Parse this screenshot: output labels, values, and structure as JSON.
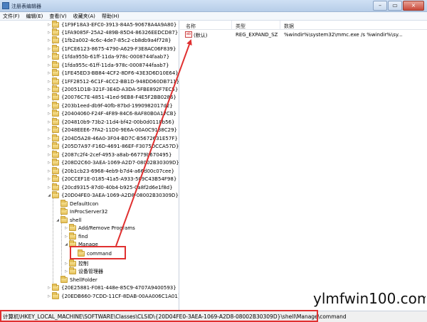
{
  "window": {
    "title": "注册表编辑器",
    "buttons": [
      "–",
      "▭",
      "×"
    ]
  },
  "menu": [
    "文件(F)",
    "编辑(E)",
    "查看(V)",
    "收藏夹(A)",
    "帮助(H)"
  ],
  "tree": [
    "{1F9F18A3-EFC0-3913-84A5-90678A4A9A80}",
    "{1FA9085F-25A2-489B-85D4-86326EEDCD87}",
    "{1fb2a002-4c6c-4de7-85c2-cb8db9a4f728}",
    "{1FCE6123-8675-4790-A629-F3E8AC06F839}",
    "{1fda955b-61ff-11da-978c-0008744faab7}",
    "{1fda955c-61ff-11da-978c-0008744faab7}",
    "{1FE45ED3-BB84-4CF2-8DF6-43E3D6D10E64}",
    "{1FF28512-6C1F-4CC2-BB1D-948DD60DB711}",
    "{20051D1B-321F-3E4D-A3DA-5FBE892F7EC5}",
    "{20076C7E-4851-41ed-9EB8-F4E5F2BB0286}",
    "{203b1eed-db9f-40fb-87bd-1990982017d2}",
    "{20404060-F24F-4F89-84C6-8AF80B0A17CB}",
    "{204810b9-73b2-11d4-bf42-00b0d0118b56}",
    "{2048EEE6-7FA2-11D0-9E6A-00A0C9138C29}",
    "{204D5A28-46A0-3F04-BD7C-B5672631E57F}",
    "{205D7A97-F16D-4691-86EF-F3075DCCA57D}",
    "{2087c2f4-2cef-4953-a8ab-66779b670495}",
    "{208D2C60-3AEA-1069-A2D7-08002B30309D}",
    "{20b1cb23-6968-4eb9-b7d4-a66d00c07cee}",
    "{20CCEF1E-0185-41a5-A933-509C43B54F98}",
    "{20cd9315-87d0-40b4-b925-0a8f2d6e1f8d}",
    "{20D04FE0-3AEA-1069-A2D8-08002B30309D}",
    "DefaultIcon",
    "InProcServer32",
    "shell",
    "Add/Remove Programs",
    "find",
    "Manage",
    "command",
    "控制",
    "设备管理器",
    "ShellFolder",
    "{20E25881-F081-448e-85C9-4707A9400593}",
    "{20EDB660-7CDD-11CF-8DAB-00AA006C1A01}"
  ],
  "list": {
    "headers": [
      "名称",
      "类型",
      "数据"
    ],
    "row": {
      "name": "(默认)",
      "icon": "ab",
      "type": "REG_EXPAND_SZ",
      "data": "%windir%\\system32\\mmc.exe /s %windir%\\sy..."
    }
  },
  "status": {
    "path": "计算机\\HKEY_LOCAL_MACHINE\\SOFTWARE\\Classes\\CLSID\\{20D04FE0-3AEA-1069-A2D8-08002B30309D}\\shell\\Manage\\command"
  },
  "watermark": {
    "text": "ylmfwin100.com"
  },
  "colors": {
    "highlight": "#e03030",
    "folder": "#e5c15a",
    "titlebar": "#cfe0f4"
  }
}
